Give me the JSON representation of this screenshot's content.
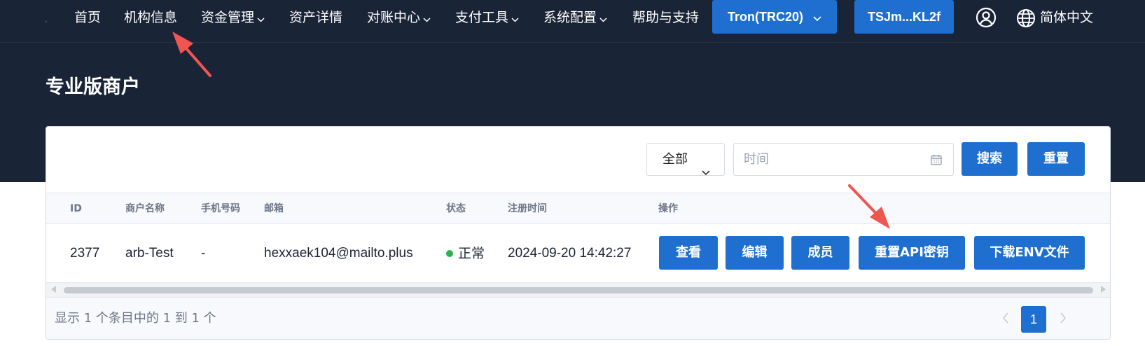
{
  "nav": {
    "dot": "·",
    "items": [
      {
        "label": "首页"
      },
      {
        "label": "机构信息"
      },
      {
        "label": "资金管理"
      },
      {
        "label": "资产详情"
      },
      {
        "label": "对账中心"
      },
      {
        "label": "支付工具"
      },
      {
        "label": "系统配置"
      },
      {
        "label": "帮助与支持"
      }
    ],
    "network_label": "Tron(TRC20)",
    "wallet_label": "TSJm...KL2f",
    "language_label": "简体中文"
  },
  "page": {
    "title": "专业版商户"
  },
  "filters": {
    "status_value": "全部",
    "time_placeholder": "时间",
    "search_label": "搜索",
    "reset_label": "重置"
  },
  "table": {
    "columns": [
      "ID",
      "商户名称",
      "手机号码",
      "邮箱",
      "状态",
      "注册时间",
      "操作"
    ],
    "rows": [
      {
        "id": "2377",
        "name": "arb-Test",
        "phone": "-",
        "email": "hexxaek104@mailto.plus",
        "status": "正常",
        "registered": "2024-09-20 14:42:27"
      }
    ],
    "actions": {
      "view": "查看",
      "edit": "编辑",
      "members": "成员",
      "reset_api_key": "重置API密钥",
      "download_env": "下载ENV文件"
    }
  },
  "footer": {
    "info": "显示 1 个条目中的 1 到 1 个",
    "current_page": "1"
  },
  "colors": {
    "nav_bg": "#1a2437",
    "primary": "#1f6fd0",
    "status_ok": "#2cb34a",
    "annotation_arrow": "#f05650"
  }
}
